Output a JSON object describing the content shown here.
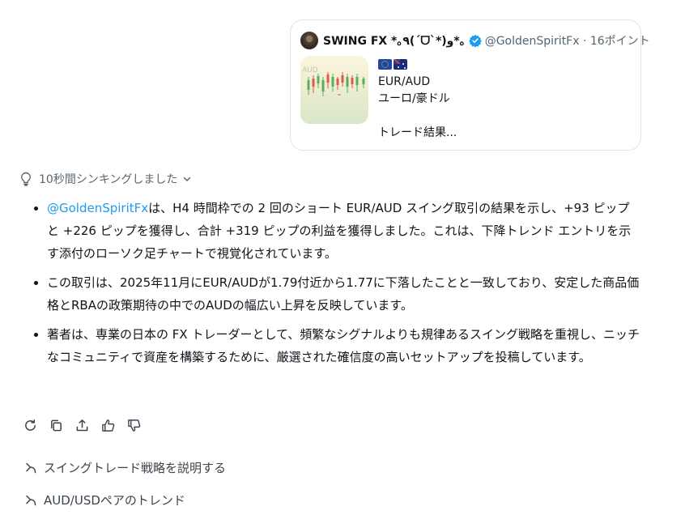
{
  "quote": {
    "name": "SWING FX *｡٩(ˊᗜˋ*)و*｡",
    "handle_points": "@GoldenSpiritFx · 16ポイント",
    "pair": "EUR/AUD",
    "pair_jp": "ユーロ/豪ドル",
    "snippet": "トレード結果...",
    "thumb_label": "AUD"
  },
  "thinking": {
    "label": "10秒間シンキングしました"
  },
  "answer": {
    "bullet1_mention": "@GoldenSpiritFx",
    "bullet1_text": "は、H4 時間枠での 2 回のショート EUR/AUD スイング取引の結果を示し、+93 ピップと +226 ピップを獲得し、合計 +319 ピップの利益を獲得しました。これは、下降トレンド エントリを示す添付のローソク足チャートで視覚化されています。",
    "bullet2_text": "この取引は、2025年11月にEUR/AUDが1.79付近から1.77に下落したことと一致しており、安定した商品価格とRBAの政策期待の中でのAUDの幅広い上昇を反映しています。",
    "bullet3_text": "著者は、専業の日本の FX トレーダーとして、頻繁なシグナルよりも規律あるスイング戦略を重視し、ニッチなコミュニティで資産を構築するために、厳選された確信度の高いセットアップを投稿しています。"
  },
  "suggestions": [
    {
      "label": "スイングトレード戦略を説明する"
    },
    {
      "label": "AUD/USDペアのトレンド"
    }
  ],
  "icons": {
    "actions": [
      "refresh-icon",
      "copy-icon",
      "share-icon",
      "thumbs-up-icon",
      "thumbs-down-icon"
    ],
    "thinking": "lightbulb-icon",
    "suggestion": "arrow-turn-icon"
  },
  "colors": {
    "mention": "#1d9bf0",
    "verified": "#1d9bf0",
    "candle_up": "#5cae5c",
    "candle_down": "#e0584e"
  }
}
